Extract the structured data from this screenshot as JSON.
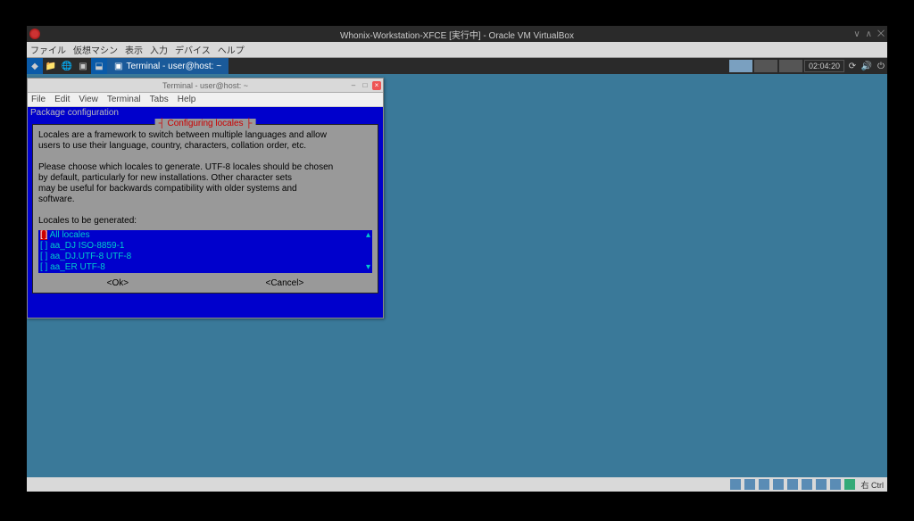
{
  "vbox": {
    "title": "Whonix-Workstation-XFCE [実行中] - Oracle VM VirtualBox",
    "menu": {
      "file": "ファイル",
      "vm": "仮想マシン",
      "view": "表示",
      "input": "入力",
      "device": "デバイス",
      "help": "ヘルプ"
    },
    "status_host": "右 Ctrl"
  },
  "taskbar": {
    "app_label": "Terminal - user@host: ~",
    "clock": "02:04:20"
  },
  "terminal": {
    "title": "Terminal - user@host: ~",
    "menu": {
      "file": "File",
      "edit": "Edit",
      "view": "View",
      "terminal": "Terminal",
      "tabs": "Tabs",
      "help": "Help"
    },
    "pkg_line": "Package configuration"
  },
  "dialog": {
    "title": "Configuring locales",
    "text_l1": "Locales are a framework to switch between multiple languages and allow",
    "text_l2": "users to use their language, country, characters, collation order, etc.",
    "text_l3": "Please choose which locales to generate. UTF-8 locales should be chosen",
    "text_l4": "by default, particularly for new installations. Other character sets",
    "text_l5": "may be useful for backwards compatibility with older systems and",
    "text_l6": "software.",
    "text_l7": "Locales to be generated:",
    "list": {
      "opt0": "[ ] All locales",
      "opt1": "[ ] aa_DJ ISO-8859-1",
      "opt2": "[ ] aa_DJ.UTF-8 UTF-8",
      "opt3": "[ ] aa_ER UTF-8"
    },
    "ok": "<Ok>",
    "cancel": "<Cancel>"
  }
}
